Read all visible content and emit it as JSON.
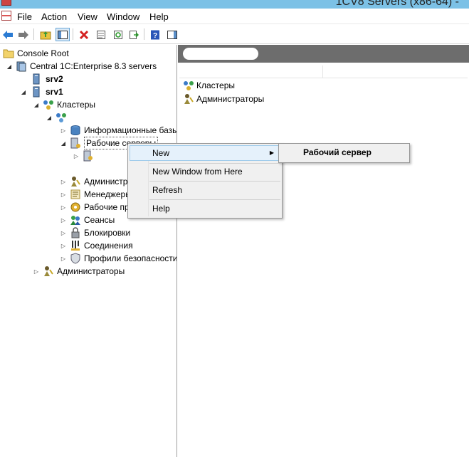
{
  "window": {
    "title": "1CV8 Servers (x86-64) -"
  },
  "menu": [
    "File",
    "Action",
    "View",
    "Window",
    "Help"
  ],
  "toolbar": {
    "buttons": [
      "back-icon",
      "forward-icon",
      "up-folder-icon",
      "show-hide-tree-icon",
      "delete-icon",
      "properties-icon",
      "refresh-icon",
      "export-list-icon",
      "help-icon",
      "show-hide-action-pane-icon"
    ]
  },
  "tree": {
    "root": "Console Root",
    "central": "Central 1C:Enterprise 8.3 servers",
    "srv2": "srv2",
    "srv1": "srv1",
    "clusters": "Кластеры",
    "cluster_name": "",
    "infobases": "Информационные базы",
    "working_servers": "Рабочие серверы",
    "cluster_admins": "Администраторы",
    "cluster_managers": "Менеджеры кластера",
    "working_processes": "Рабочие процессы",
    "sessions": "Сеансы",
    "locks": "Блокировки",
    "connections": "Соединения",
    "security_profiles": "Профили безопасности",
    "server_admins": "Администраторы"
  },
  "list": {
    "items": [
      "Кластеры",
      "Администраторы"
    ]
  },
  "context_menu": {
    "new": "New",
    "new_window": "New Window from Here",
    "refresh": "Refresh",
    "help": "Help"
  },
  "submenu": {
    "working_server": "Рабочий сервер"
  },
  "colors": {
    "titlebar": "#7cc1e6",
    "highlight": "#e5f1fb",
    "header_bar": "#6d6d6d"
  }
}
